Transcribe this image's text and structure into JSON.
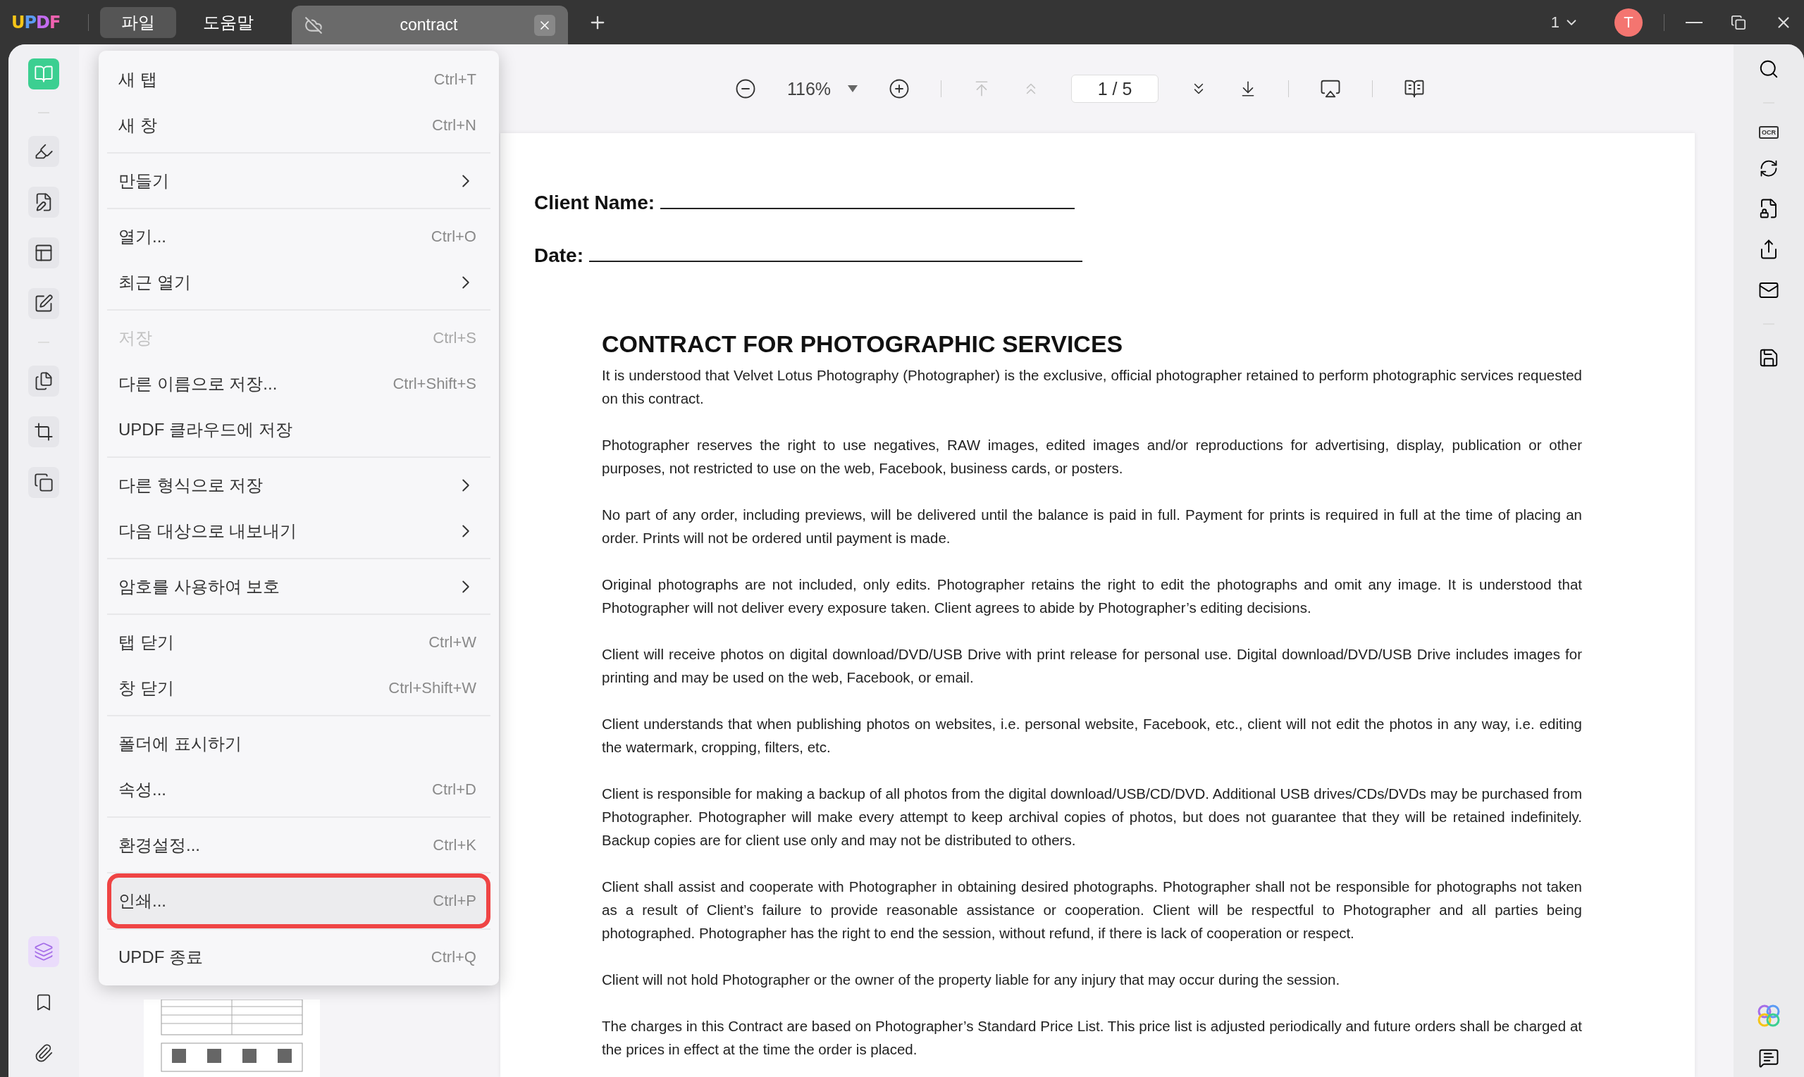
{
  "titlebar": {
    "logo": "UPDF",
    "menus": [
      {
        "label": "파일",
        "selected": true
      },
      {
        "label": "도움말",
        "selected": false
      }
    ],
    "tab": {
      "title": "contract"
    },
    "window_count": "1",
    "avatar": "T"
  },
  "left_rail": {
    "tools": [
      {
        "selected": true
      },
      {
        "selected": false
      },
      {
        "selected": false
      },
      {
        "selected": false
      },
      {
        "selected": false
      },
      {
        "selected": false
      },
      {
        "selected": false
      },
      {
        "selected": false
      }
    ],
    "bottom_tools": [
      {
        "selected": true
      },
      {
        "selected": false
      },
      {
        "selected": false
      }
    ]
  },
  "toolbar": {
    "zoom": "116%",
    "page": "1 / 5",
    "nav": [
      {
        "disabled": true
      },
      {
        "disabled": true
      },
      {
        "disabled": false
      },
      {
        "disabled": false
      }
    ]
  },
  "file_menu": {
    "groups": [
      [
        {
          "label": "새 탭",
          "shortcut": "Ctrl+T",
          "submenu": false,
          "disabled": false,
          "highlighted": false
        },
        {
          "label": "새 창",
          "shortcut": "Ctrl+N",
          "submenu": false,
          "disabled": false,
          "highlighted": false
        }
      ],
      [
        {
          "label": "만들기",
          "submenu": true,
          "disabled": false,
          "highlighted": false
        }
      ],
      [
        {
          "label": "열기...",
          "shortcut": "Ctrl+O",
          "submenu": false,
          "disabled": false,
          "highlighted": false
        },
        {
          "label": "최근 열기",
          "submenu": true,
          "disabled": false,
          "highlighted": false
        }
      ],
      [
        {
          "label": "저장",
          "shortcut": "Ctrl+S",
          "submenu": false,
          "disabled": true,
          "highlighted": false
        },
        {
          "label": "다른 이름으로 저장...",
          "shortcut": "Ctrl+Shift+S",
          "submenu": false,
          "disabled": false,
          "highlighted": false
        },
        {
          "label": "UPDF 클라우드에 저장",
          "submenu": false,
          "disabled": false,
          "highlighted": false
        }
      ],
      [
        {
          "label": "다른 형식으로 저장",
          "submenu": true,
          "disabled": false,
          "highlighted": false
        },
        {
          "label": "다음 대상으로 내보내기",
          "submenu": true,
          "disabled": false,
          "highlighted": false
        }
      ],
      [
        {
          "label": "암호를 사용하여 보호",
          "submenu": true,
          "disabled": false,
          "highlighted": false
        }
      ],
      [
        {
          "label": "탭 닫기",
          "shortcut": "Ctrl+W",
          "submenu": false,
          "disabled": false,
          "highlighted": false
        },
        {
          "label": "창 닫기",
          "shortcut": "Ctrl+Shift+W",
          "submenu": false,
          "disabled": false,
          "highlighted": false
        }
      ],
      [
        {
          "label": "폴더에 표시하기",
          "submenu": false,
          "disabled": false,
          "highlighted": false
        },
        {
          "label": "속성...",
          "shortcut": "Ctrl+D",
          "submenu": false,
          "disabled": false,
          "highlighted": false
        }
      ],
      [
        {
          "label": "환경설정...",
          "shortcut": "Ctrl+K",
          "submenu": false,
          "disabled": false,
          "highlighted": false
        }
      ],
      [
        {
          "label": "인쇄...",
          "shortcut": "Ctrl+P",
          "submenu": false,
          "disabled": false,
          "highlighted": true
        }
      ],
      [
        {
          "label": "UPDF 종료",
          "shortcut": "Ctrl+Q",
          "submenu": false,
          "disabled": false,
          "highlighted": false
        }
      ]
    ]
  },
  "document": {
    "fields": [
      {
        "label": "Client Name:"
      },
      {
        "label": "Date:"
      }
    ],
    "title": "CONTRACT FOR PHOTOGRAPHIC SERVICES",
    "paragraphs": [
      "It is understood that Velvet Lotus Photography (Photographer) is the exclusive, official photographer retained to perform photographic services requested on this contract.",
      "Photographer reserves the right to use negatives, RAW images, edited images and/or reproductions for advertising, display, publication or other purposes, not restricted to use on the web, Facebook, business cards, or posters.",
      "No part of any order, including previews, will be delivered until the balance is paid in full. Payment for prints is required in full at the time of placing an order. Prints will not be ordered until payment is made.",
      "Original photographs are not included, only edits. Photographer retains the right to edit the photographs and omit any image. It is understood that Photographer will not deliver every exposure taken. Client agrees to abide by Photographer’s editing decisions.",
      "Client will receive photos on digital download/DVD/USB Drive with print release for personal use. Digital download/DVD/USB Drive includes images for printing and may be used on the web, Facebook, or email.",
      "Client understands that when publishing photos on websites, i.e. personal website, Facebook, etc., client will not edit the photos in any way, i.e. editing the watermark, cropping, filters, etc.",
      "Client is responsible for making a backup of all photos from the digital download/USB/CD/DVD. Additional USB drives/CDs/DVDs may be purchased from Photographer. Photographer will make every attempt to keep archival copies of photos, but does not guarantee that they will be retained indefinitely. Backup copies are for client use only and may not be distributed to others.",
      "Client shall assist and cooperate with Photographer in obtaining desired photographs. Photographer shall not be responsible for photographs not taken as a result of Client’s failure to provide reasonable assistance or cooperation. Client will be respectful to Photographer and all parties being photographed. Photographer has the right to end the session, without refund, if there is lack of cooperation or respect.",
      "Client will not hold Photographer or the owner of the property liable for any injury that may occur during the session.",
      "The charges in this Contract are based on Photographer’s Standard Price List. This price list is adjusted periodically and future orders shall be charged at the prices in effect at the time the order is placed."
    ]
  },
  "right_rail": {
    "ocr_label": "OCR"
  }
}
